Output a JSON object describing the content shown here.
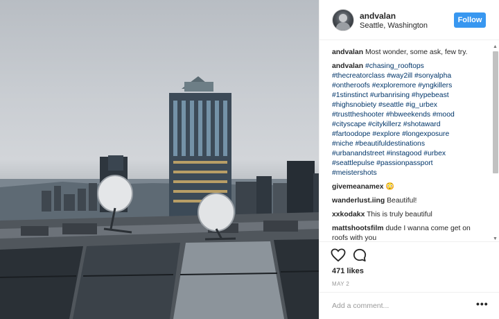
{
  "post": {
    "username": "andvalan",
    "location": "Seattle, Washington",
    "follow_label": "Follow"
  },
  "caption": {
    "username": "andvalan",
    "text": "Most wonder, some ask, few try."
  },
  "hashtag_comment": {
    "username": "andvalan",
    "lines": [
      "#chasing_rooftops",
      "#thecreatorclass #way2ill #sonyalpha",
      "#ontheroofs #exploremore #yngkillers",
      "#1stinstinct #urbanrising #hypebeast",
      "#highsnobiety #seattle #ig_urbex",
      "#trusttheshooter #hbweekends #mood",
      "#cityscape #citykillerz #shotaward",
      "#fartoodope #explore #longexposure",
      "#niche #beautifuldestinations",
      "#urbanandstreet #instagood #urbex",
      "#seattlepulse #passionpassport",
      "#meistershots"
    ]
  },
  "comments": [
    {
      "username": "givemeanamex",
      "text": "😳"
    },
    {
      "username": "wanderlust.iing",
      "text": "Beautiful!"
    },
    {
      "username": "xxkodakx",
      "text": "This is truly beautiful"
    },
    {
      "username": "mattshootsfilm",
      "text": "dude I wanna come get on roofs with you"
    }
  ],
  "likes_text": "471 likes",
  "date_text": "MAY 2",
  "add_comment_placeholder": "Add a comment...",
  "more_options": "•••",
  "icons": [
    "heart-icon",
    "comment-icon",
    "more-options-icon"
  ],
  "colors": {
    "follow_button": "#3897f0",
    "hashtag": "#003569",
    "divider": "#efefef"
  }
}
